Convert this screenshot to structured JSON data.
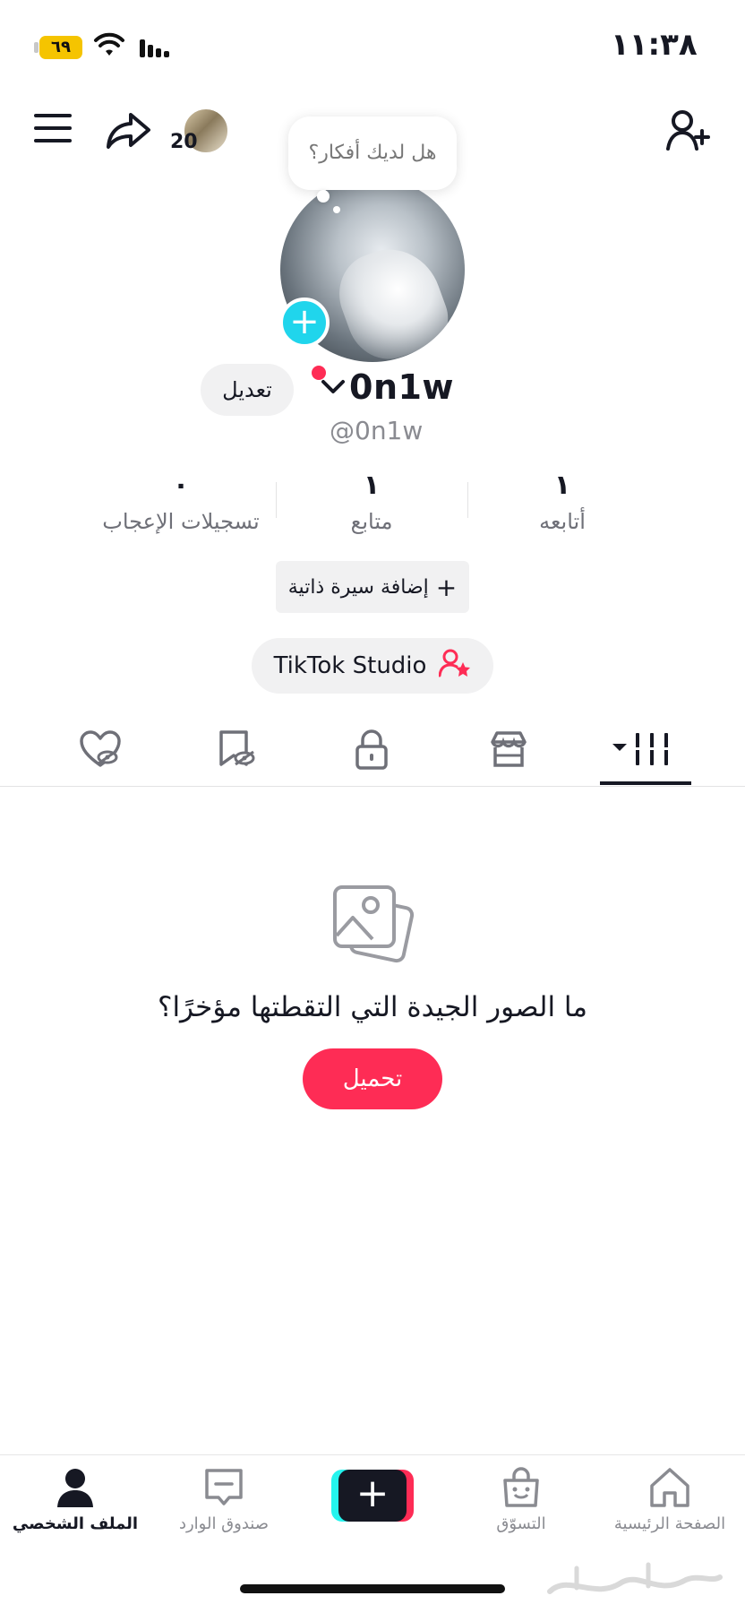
{
  "status_bar": {
    "time": "١١:٣٨",
    "battery": "٦٩"
  },
  "header": {
    "mini_count": "20"
  },
  "bubble": {
    "text": "هل لديك أفكار؟"
  },
  "profile": {
    "edit_label": "تعديل",
    "username": "0n1w",
    "handle": "@0n1w"
  },
  "stats": [
    {
      "value": "١",
      "label": "أتابعه"
    },
    {
      "value": "١",
      "label": "متابع"
    },
    {
      "value": "٠",
      "label": "تسجيلات الإعجاب"
    }
  ],
  "bio_button": {
    "label": "إضافة سيرة ذاتية",
    "plus": "+"
  },
  "studio_button": {
    "label": "TikTok Studio"
  },
  "empty_state": {
    "title": "ما الصور الجيدة التي التقطتها مؤخرًا؟",
    "button": "تحميل"
  },
  "bottom_nav": {
    "home": "الصفحة الرئيسية",
    "shop": "التسوّق",
    "create": "+",
    "inbox": "صندوق الوارد",
    "profile": "الملف الشخصي"
  },
  "colors": {
    "accent": "#fe2c55",
    "cyan": "#20d5ec",
    "text": "#161823"
  }
}
